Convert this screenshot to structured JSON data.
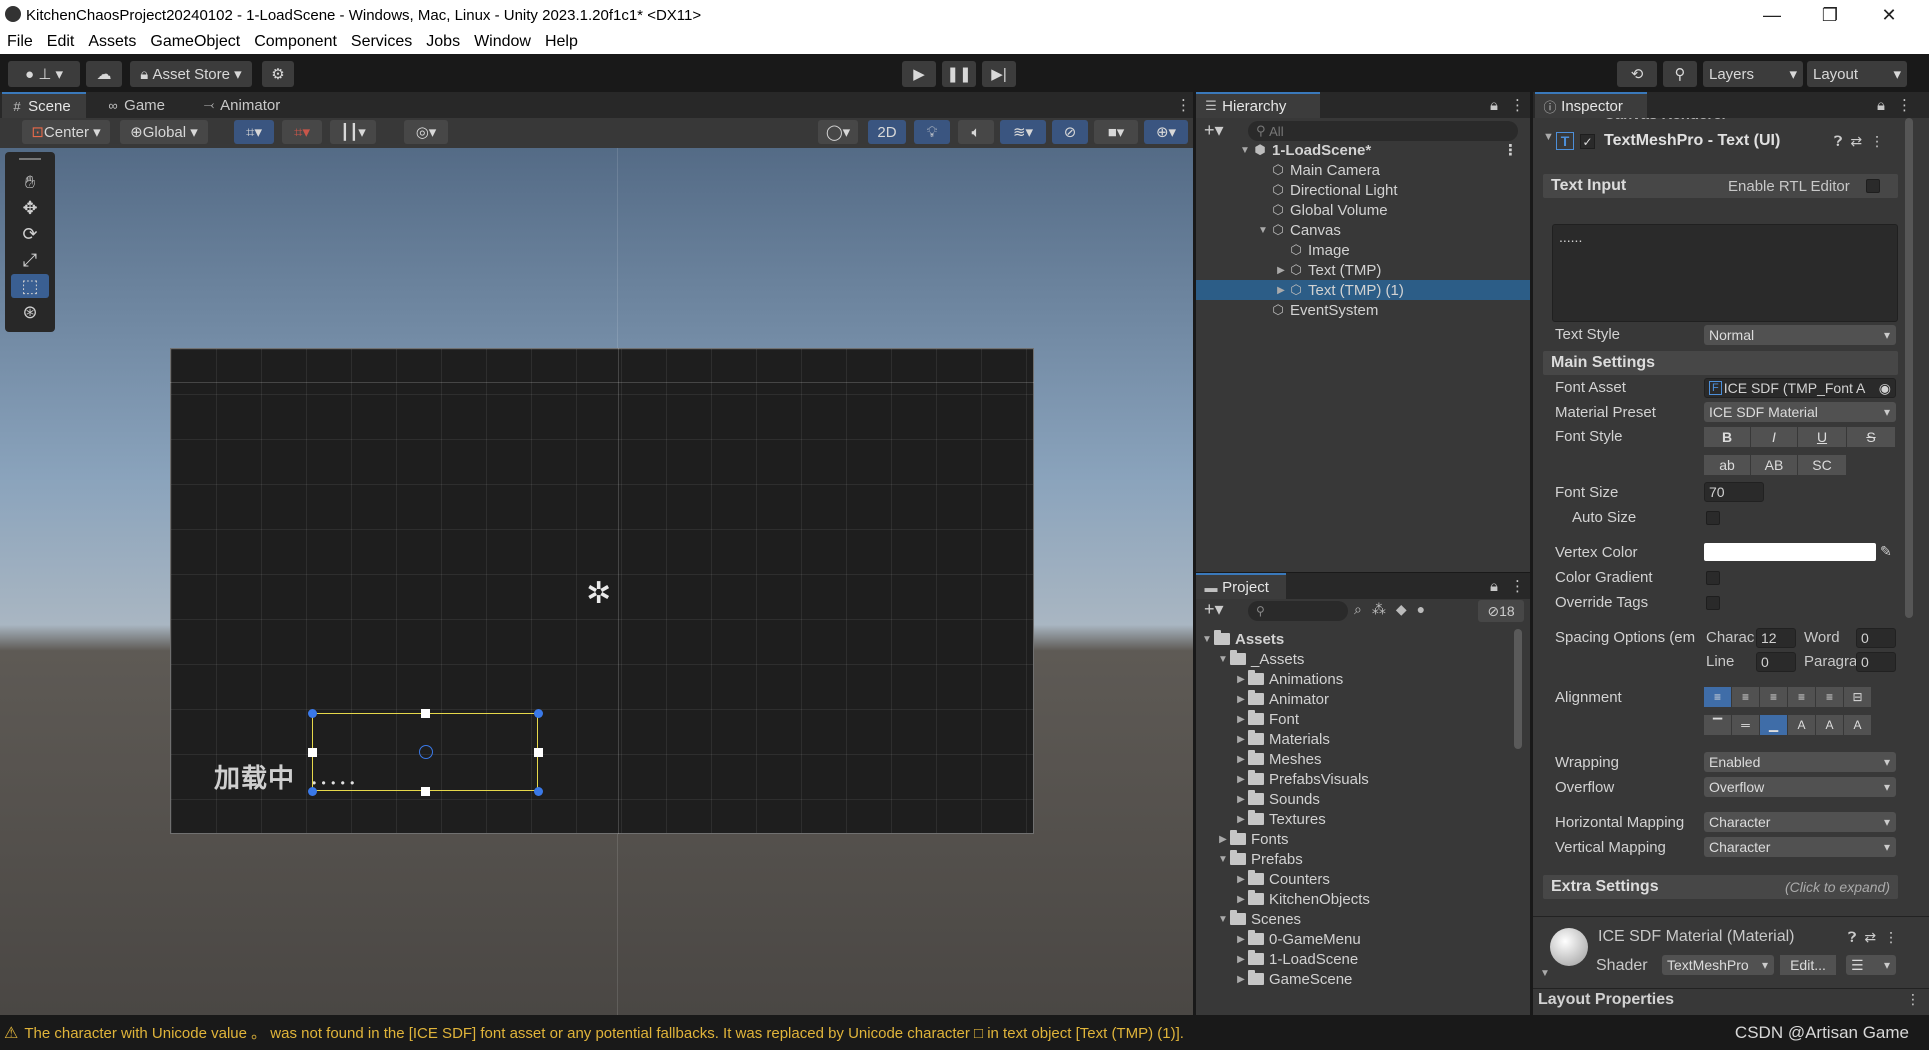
{
  "window": {
    "title": "KitchenChaosProject20240102 - 1-LoadScene - Windows, Mac, Linux - Unity 2023.1.20f1c1* <DX11>"
  },
  "menu": [
    "File",
    "Edit",
    "Assets",
    "GameObject",
    "Component",
    "Services",
    "Jobs",
    "Window",
    "Help"
  ],
  "toolbar": {
    "asset_store": "Asset Store",
    "layers": "Layers",
    "layout": "Layout"
  },
  "scene_tabs": [
    "Scene",
    "Game",
    "Animator"
  ],
  "scene_toolbar": {
    "pivot": "Center",
    "space": "Global",
    "mode_2d": "2D"
  },
  "scene": {
    "loading_text": "加载中",
    "dots": "• • • • •"
  },
  "hierarchy": {
    "tab": "Hierarchy",
    "search_placeholder": "All",
    "scene_name": "1-LoadScene*",
    "items": [
      {
        "label": "Main Camera"
      },
      {
        "label": "Directional Light"
      },
      {
        "label": "Global Volume"
      },
      {
        "label": "Canvas"
      },
      {
        "label": "Image"
      },
      {
        "label": "Text (TMP)"
      },
      {
        "label": "Text (TMP) (1)"
      },
      {
        "label": "EventSystem"
      }
    ]
  },
  "project": {
    "tab": "Project",
    "hidden_count": "18",
    "items": [
      {
        "label": "Assets"
      },
      {
        "label": "_Assets"
      },
      {
        "label": "Animations"
      },
      {
        "label": "Animator"
      },
      {
        "label": "Font"
      },
      {
        "label": "Materials"
      },
      {
        "label": "Meshes"
      },
      {
        "label": "PrefabsVisuals"
      },
      {
        "label": "Sounds"
      },
      {
        "label": "Textures"
      },
      {
        "label": "Fonts"
      },
      {
        "label": "Prefabs"
      },
      {
        "label": "Counters"
      },
      {
        "label": "KitchenObjects"
      },
      {
        "label": "Scenes"
      },
      {
        "label": "0-GameMenu"
      },
      {
        "label": "1-LoadScene"
      },
      {
        "label": "GameScene"
      }
    ]
  },
  "inspector": {
    "tab": "Inspector",
    "prev_component": "Canvas Renderer",
    "component": "TextMeshPro - Text (UI)",
    "text_input_header": "Text Input",
    "rtl_label": "Enable RTL Editor",
    "text_value": "......",
    "text_style_label": "Text Style",
    "text_style_value": "Normal",
    "main_settings": "Main Settings",
    "font_asset_label": "Font Asset",
    "font_asset_value": "ICE SDF (TMP_Font A",
    "material_preset_label": "Material Preset",
    "material_preset_value": "ICE SDF Material",
    "font_style_label": "Font Style",
    "font_style_buttons": [
      "B",
      "I",
      "U",
      "S",
      "ab",
      "AB",
      "SC"
    ],
    "font_size_label": "Font Size",
    "font_size_value": "70",
    "auto_size_label": "Auto Size",
    "vertex_color_label": "Vertex Color",
    "color_gradient_label": "Color Gradient",
    "override_tags_label": "Override Tags",
    "spacing_label": "Spacing Options (em",
    "charac_label": "Charac",
    "charac_value": "12",
    "word_label": "Word",
    "word_value": "0",
    "line_label": "Line",
    "line_value": "0",
    "paragraph_label": "Paragra",
    "paragraph_value": "0",
    "alignment_label": "Alignment",
    "wrapping_label": "Wrapping",
    "wrapping_value": "Enabled",
    "overflow_label": "Overflow",
    "overflow_value": "Overflow",
    "hmapping_label": "Horizontal Mapping",
    "hmapping_value": "Character",
    "vmapping_label": "Vertical Mapping",
    "vmapping_value": "Character",
    "extra_settings": "Extra Settings",
    "click_to_expand": "(Click to expand)",
    "material_name": "ICE SDF Material (Material)",
    "shader_label": "Shader",
    "shader_value": "TextMeshPro",
    "edit_button": "Edit...",
    "layout_properties": "Layout Properties"
  },
  "status": {
    "message": "The character with Unicode value 。 was not found in the [ICE SDF] font asset or any potential fallbacks. It was replaced by Unicode character □ in text object [Text (TMP) (1)].",
    "watermark": "CSDN @Artisan Game"
  },
  "colors": {
    "selection": "#2c5d87",
    "accent": "#3a79bb",
    "warning": "#e0b43a",
    "rect_outline": "#e6d84a"
  }
}
